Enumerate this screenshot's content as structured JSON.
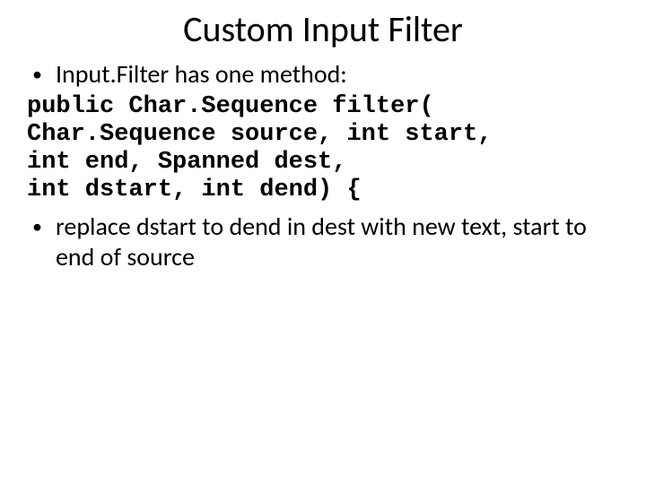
{
  "title": "Custom Input Filter",
  "bullets": {
    "b1": "Input.Filter has one method:",
    "b2": "replace dstart to dend in dest with new text, start to end of source"
  },
  "code": {
    "line1": "public Char.Sequence filter(",
    "line2": "Char.Sequence source, int start,",
    "line3": "int end, Spanned dest,",
    "line4": "int dstart, int dend) {"
  },
  "glyphs": {
    "bullet": "•"
  }
}
